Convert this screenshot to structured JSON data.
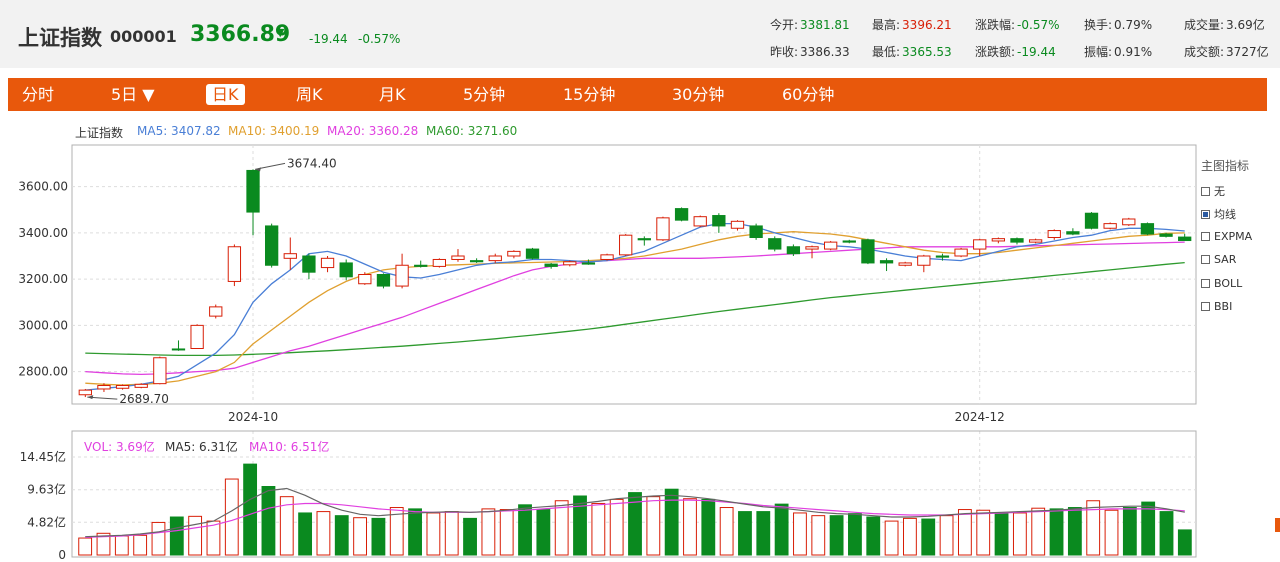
{
  "header": {
    "name": "上证指数",
    "code": "000001",
    "price": "3366.89",
    "arrow": "▼",
    "change": "-19.44",
    "change_pct": "-0.57%",
    "stats": {
      "open_label": "今开:",
      "open": "3381.81",
      "high_label": "最高:",
      "high": "3396.21",
      "chg_pct_label": "涨跌幅:",
      "chg_pct": "-0.57%",
      "turnover_label": "换手:",
      "turnover": "0.79%",
      "volume_label": "成交量:",
      "volume": "3.69亿",
      "prev_close_label": "昨收:",
      "prev_close": "3386.33",
      "low_label": "最低:",
      "low": "3365.53",
      "chg_amt_label": "涨跌额:",
      "chg_amt": "-19.44",
      "amplitude_label": "振幅:",
      "amplitude": "0.91%",
      "amount_label": "成交额:",
      "amount": "3727亿"
    }
  },
  "tabs": [
    "分时",
    "5日 ▼",
    "日K",
    "周K",
    "月K",
    "5分钟",
    "15分钟",
    "30分钟",
    "60分钟"
  ],
  "active_tab": 2,
  "ma_legend": {
    "name": "上证指数",
    "ma5": "MA5: 3407.82",
    "ma10": "MA10: 3400.19",
    "ma20": "MA20: 3360.28",
    "ma60": "MA60: 3271.60"
  },
  "indicators": {
    "title": "主图指标",
    "items": [
      {
        "label": "无",
        "checked": false
      },
      {
        "label": "均线",
        "checked": true
      },
      {
        "label": "EXPMA",
        "checked": false
      },
      {
        "label": "SAR",
        "checked": false
      },
      {
        "label": "BOLL",
        "checked": false
      },
      {
        "label": "BBI",
        "checked": false
      }
    ]
  },
  "vol_legend": {
    "vol": "VOL: 3.69亿",
    "ma5": "MA5: 6.31亿",
    "ma10": "MA10: 6.51亿"
  },
  "colors": {
    "up": "#d81e06",
    "down": "#0a8a1f",
    "ma5": "#4a7fd6",
    "ma10": "#e0a030",
    "ma20": "#e040e0",
    "ma60": "#2e9a2e",
    "accent": "#e8580c"
  },
  "chart_data": {
    "type": "candlestick",
    "price_ticks": [
      "3600.00",
      "3400.00",
      "3200.00",
      "3000.00",
      "2800.00"
    ],
    "price_tick_values": [
      3600,
      3400,
      3200,
      3000,
      2800
    ],
    "price_range": [
      2660,
      3780
    ],
    "x_labels": [
      {
        "label": "2024-10",
        "index": 9
      },
      {
        "label": "2024-12",
        "index": 48
      }
    ],
    "annotations": [
      {
        "label": "3674.40",
        "index": 9,
        "value": 3674.4
      },
      {
        "label": "2689.70",
        "index": 0,
        "value": 2689.7
      }
    ],
    "candles": [
      {
        "o": 2700,
        "c": 2720,
        "h": 2725,
        "l": 2690
      },
      {
        "o": 2725,
        "c": 2740,
        "h": 2750,
        "l": 2712
      },
      {
        "o": 2728,
        "c": 2740,
        "h": 2745,
        "l": 2722
      },
      {
        "o": 2732,
        "c": 2745,
        "h": 2750,
        "l": 2728
      },
      {
        "o": 2748,
        "c": 2860,
        "h": 2865,
        "l": 2745
      },
      {
        "o": 2898,
        "c": 2895,
        "h": 2935,
        "l": 2890
      },
      {
        "o": 2900,
        "c": 3000,
        "h": 3005,
        "l": 2898
      },
      {
        "o": 3040,
        "c": 3080,
        "h": 3090,
        "l": 3030
      },
      {
        "o": 3190,
        "c": 3340,
        "h": 3350,
        "l": 3170
      },
      {
        "o": 3670,
        "c": 3490,
        "h": 3674.4,
        "l": 3390
      },
      {
        "o": 3430,
        "c": 3260,
        "h": 3440,
        "l": 3250
      },
      {
        "o": 3290,
        "c": 3310,
        "h": 3380,
        "l": 3240
      },
      {
        "o": 3300,
        "c": 3230,
        "h": 3310,
        "l": 3200
      },
      {
        "o": 3250,
        "c": 3290,
        "h": 3300,
        "l": 3230
      },
      {
        "o": 3270,
        "c": 3210,
        "h": 3285,
        "l": 3195
      },
      {
        "o": 3180,
        "c": 3220,
        "h": 3230,
        "l": 3175
      },
      {
        "o": 3220,
        "c": 3170,
        "h": 3225,
        "l": 3160
      },
      {
        "o": 3170,
        "c": 3260,
        "h": 3310,
        "l": 3160
      },
      {
        "o": 3260,
        "c": 3255,
        "h": 3280,
        "l": 3250
      },
      {
        "o": 3255,
        "c": 3285,
        "h": 3290,
        "l": 3250
      },
      {
        "o": 3285,
        "c": 3300,
        "h": 3330,
        "l": 3275
      },
      {
        "o": 3280,
        "c": 3275,
        "h": 3290,
        "l": 3270
      },
      {
        "o": 3280,
        "c": 3300,
        "h": 3310,
        "l": 3270
      },
      {
        "o": 3300,
        "c": 3320,
        "h": 3325,
        "l": 3290
      },
      {
        "o": 3330,
        "c": 3290,
        "h": 3335,
        "l": 3285
      },
      {
        "o": 3265,
        "c": 3255,
        "h": 3270,
        "l": 3245
      },
      {
        "o": 3262,
        "c": 3275,
        "h": 3280,
        "l": 3255
      },
      {
        "o": 3270,
        "c": 3265,
        "h": 3285,
        "l": 3262
      },
      {
        "o": 3285,
        "c": 3305,
        "h": 3310,
        "l": 3280
      },
      {
        "o": 3305,
        "c": 3390,
        "h": 3395,
        "l": 3300
      },
      {
        "o": 3375,
        "c": 3370,
        "h": 3385,
        "l": 3345
      },
      {
        "o": 3370,
        "c": 3465,
        "h": 3470,
        "l": 3365
      },
      {
        "o": 3505,
        "c": 3455,
        "h": 3510,
        "l": 3450
      },
      {
        "o": 3430,
        "c": 3470,
        "h": 3475,
        "l": 3425
      },
      {
        "o": 3475,
        "c": 3430,
        "h": 3485,
        "l": 3400
      },
      {
        "o": 3420,
        "c": 3450,
        "h": 3455,
        "l": 3410
      },
      {
        "o": 3430,
        "c": 3380,
        "h": 3440,
        "l": 3370
      },
      {
        "o": 3375,
        "c": 3330,
        "h": 3385,
        "l": 3320
      },
      {
        "o": 3340,
        "c": 3310,
        "h": 3350,
        "l": 3300
      },
      {
        "o": 3330,
        "c": 3340,
        "h": 3345,
        "l": 3290
      },
      {
        "o": 3330,
        "c": 3360,
        "h": 3365,
        "l": 3325
      },
      {
        "o": 3365,
        "c": 3360,
        "h": 3370,
        "l": 3355
      },
      {
        "o": 3370,
        "c": 3270,
        "h": 3375,
        "l": 3265
      },
      {
        "o": 3280,
        "c": 3270,
        "h": 3290,
        "l": 3235
      },
      {
        "o": 3260,
        "c": 3270,
        "h": 3275,
        "l": 3255
      },
      {
        "o": 3260,
        "c": 3300,
        "h": 3305,
        "l": 3230
      },
      {
        "o": 3300,
        "c": 3295,
        "h": 3310,
        "l": 3280
      },
      {
        "o": 3300,
        "c": 3330,
        "h": 3335,
        "l": 3295
      },
      {
        "o": 3330,
        "c": 3370,
        "h": 3375,
        "l": 3300
      },
      {
        "o": 3365,
        "c": 3375,
        "h": 3380,
        "l": 3355
      },
      {
        "o": 3375,
        "c": 3360,
        "h": 3380,
        "l": 3350
      },
      {
        "o": 3360,
        "c": 3370,
        "h": 3375,
        "l": 3355
      },
      {
        "o": 3380,
        "c": 3410,
        "h": 3415,
        "l": 3370
      },
      {
        "o": 3405,
        "c": 3395,
        "h": 3420,
        "l": 3390
      },
      {
        "o": 3485,
        "c": 3420,
        "h": 3490,
        "l": 3415
      },
      {
        "o": 3420,
        "c": 3440,
        "h": 3445,
        "l": 3415
      },
      {
        "o": 3435,
        "c": 3460,
        "h": 3465,
        "l": 3430
      },
      {
        "o": 3440,
        "c": 3395,
        "h": 3445,
        "l": 3390
      },
      {
        "o": 3395,
        "c": 3385,
        "h": 3400,
        "l": 3380
      },
      {
        "o": 3381.81,
        "c": 3366.89,
        "h": 3396.21,
        "l": 3365.53
      }
    ],
    "ma5": [
      2720,
      2728,
      2735,
      2745,
      2760,
      2780,
      2830,
      2880,
      2960,
      3100,
      3180,
      3240,
      3310,
      3320,
      3300,
      3265,
      3230,
      3210,
      3205,
      3220,
      3240,
      3260,
      3270,
      3275,
      3285,
      3285,
      3280,
      3275,
      3280,
      3300,
      3320,
      3355,
      3390,
      3425,
      3440,
      3440,
      3425,
      3400,
      3380,
      3360,
      3345,
      3340,
      3330,
      3315,
      3300,
      3290,
      3285,
      3280,
      3300,
      3320,
      3340,
      3350,
      3365,
      3380,
      3390,
      3410,
      3420,
      3420,
      3415,
      3408
    ],
    "ma10": [
      2750,
      2745,
      2742,
      2745,
      2750,
      2760,
      2780,
      2800,
      2840,
      2920,
      2980,
      3040,
      3100,
      3150,
      3190,
      3220,
      3240,
      3250,
      3255,
      3260,
      3262,
      3265,
      3268,
      3270,
      3272,
      3274,
      3276,
      3280,
      3285,
      3290,
      3300,
      3315,
      3330,
      3350,
      3370,
      3385,
      3395,
      3400,
      3405,
      3400,
      3395,
      3385,
      3370,
      3355,
      3340,
      3325,
      3315,
      3310,
      3310,
      3315,
      3325,
      3335,
      3345,
      3355,
      3365,
      3375,
      3385,
      3390,
      3398,
      3400
    ],
    "ma20": [
      2800,
      2795,
      2790,
      2788,
      2790,
      2795,
      2800,
      2805,
      2815,
      2840,
      2865,
      2890,
      2910,
      2935,
      2960,
      2985,
      3010,
      3035,
      3065,
      3095,
      3125,
      3155,
      3185,
      3215,
      3240,
      3255,
      3265,
      3275,
      3280,
      3285,
      3290,
      3290,
      3290,
      3290,
      3293,
      3296,
      3300,
      3305,
      3310,
      3315,
      3320,
      3325,
      3330,
      3335,
      3340,
      3340,
      3340,
      3340,
      3340,
      3340,
      3342,
      3344,
      3346,
      3348,
      3350,
      3352,
      3354,
      3356,
      3358,
      3360
    ],
    "ma60": [
      2880,
      2878,
      2876,
      2874,
      2872,
      2870,
      2870,
      2870,
      2872,
      2875,
      2878,
      2882,
      2886,
      2890,
      2895,
      2900,
      2905,
      2910,
      2916,
      2922,
      2928,
      2935,
      2942,
      2950,
      2958,
      2966,
      2975,
      2984,
      2994,
      3005,
      3016,
      3027,
      3038,
      3049,
      3060,
      3070,
      3080,
      3090,
      3100,
      3110,
      3120,
      3128,
      3136,
      3144,
      3152,
      3160,
      3168,
      3176,
      3184,
      3192,
      3200,
      3208,
      3216,
      3224,
      3232,
      3240,
      3248,
      3256,
      3264,
      3271.6
    ],
    "volume": {
      "unit": "亿",
      "ticks": [
        "14.45亿",
        "9.63亿",
        "4.82亿",
        "0"
      ],
      "tick_values": [
        14.45,
        9.63,
        4.82,
        0
      ],
      "max": 14.45,
      "values": [
        2.5,
        3.2,
        2.8,
        2.9,
        4.8,
        5.6,
        5.7,
        5.0,
        11.2,
        13.4,
        10.1,
        8.6,
        6.2,
        6.4,
        5.8,
        5.5,
        5.4,
        7.0,
        6.8,
        6.2,
        6.4,
        5.4,
        6.8,
        6.7,
        7.4,
        6.7,
        8.0,
        8.7,
        7.6,
        8.2,
        9.2,
        8.6,
        9.7,
        8.3,
        8.2,
        7.0,
        6.4,
        6.4,
        7.5,
        6.2,
        5.8,
        5.8,
        6.1,
        5.6,
        5.0,
        5.4,
        5.3,
        5.8,
        6.7,
        6.6,
        6.2,
        6.2,
        6.9,
        6.8,
        7.0,
        8.0,
        6.6,
        7.0,
        7.8,
        6.4,
        3.7
      ],
      "ma5": [
        2.7,
        2.8,
        2.9,
        3.1,
        3.4,
        4.0,
        4.5,
        5.0,
        6.5,
        8.2,
        9.5,
        9.8,
        8.8,
        7.5,
        6.6,
        6.0,
        5.8,
        6.0,
        6.2,
        6.3,
        6.4,
        6.3,
        6.4,
        6.6,
        6.9,
        7.1,
        7.3,
        7.6,
        7.9,
        8.3,
        8.5,
        8.7,
        8.8,
        8.6,
        8.3,
        7.9,
        7.5,
        7.1,
        6.9,
        6.6,
        6.3,
        6.1,
        6.0,
        5.8,
        5.6,
        5.6,
        5.7,
        5.9,
        6.1,
        6.2,
        6.3,
        6.4,
        6.5,
        6.6,
        6.8,
        7.0,
        7.1,
        7.2,
        7.2,
        6.8,
        6.31
      ],
      "ma10": [
        2.6,
        2.7,
        2.8,
        3.0,
        3.3,
        3.6,
        4.0,
        4.4,
        5.1,
        6.0,
        6.9,
        7.4,
        7.6,
        7.6,
        7.4,
        7.1,
        6.8,
        6.6,
        6.4,
        6.3,
        6.3,
        6.3,
        6.4,
        6.5,
        6.6,
        6.8,
        7.0,
        7.2,
        7.4,
        7.6,
        7.8,
        8.0,
        8.1,
        8.1,
        8.0,
        7.8,
        7.6,
        7.3,
        7.1,
        6.9,
        6.7,
        6.5,
        6.3,
        6.1,
        6.0,
        5.9,
        5.9,
        5.9,
        6.0,
        6.1,
        6.2,
        6.3,
        6.4,
        6.5,
        6.6,
        6.7,
        6.8,
        6.8,
        6.8,
        6.7,
        6.51
      ]
    }
  }
}
